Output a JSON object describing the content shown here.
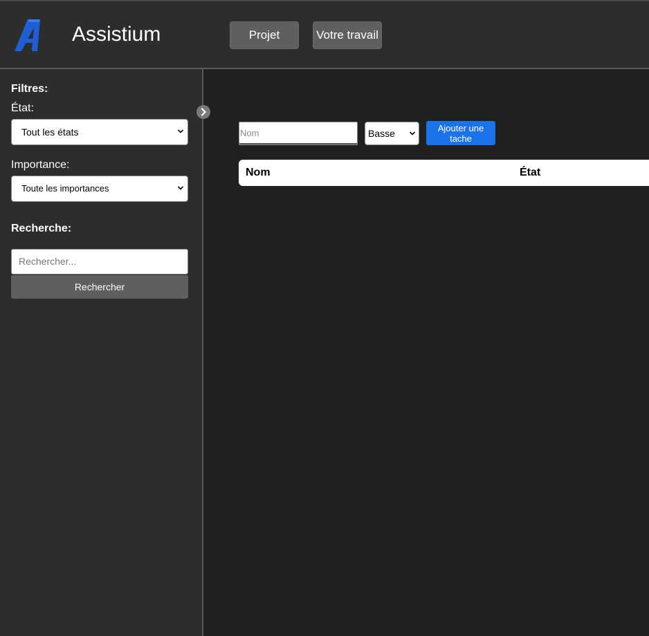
{
  "header": {
    "logo_icon": "assistium-logo-icon",
    "title": "Assistium",
    "nav": [
      "Projet",
      "Votre travail"
    ]
  },
  "sidebar": {
    "filters_heading": "Filtres:",
    "state_label": "État:",
    "state_select_value": "Tout les états",
    "importance_label": "Importance:",
    "importance_select_value": "Toute les importances",
    "search_heading": "Recherche:",
    "search_placeholder": "Rechercher...",
    "search_button": "Rechercher"
  },
  "main": {
    "task_name_placeholder": "Nom",
    "priority_value": "Basse",
    "add_button": "Ajouter une tache",
    "table_headers": [
      "Nom",
      "État"
    ]
  },
  "colors": {
    "accent": "#1a73e8",
    "logo": "#1f5fd6",
    "header_bg": "#2d2d2d",
    "main_bg": "#202020"
  }
}
